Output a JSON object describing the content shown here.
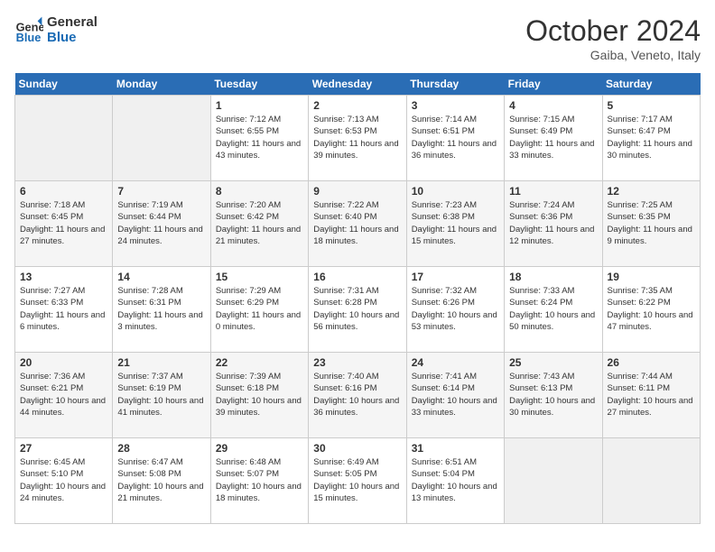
{
  "header": {
    "logo_line1": "General",
    "logo_line2": "Blue",
    "month": "October 2024",
    "location": "Gaiba, Veneto, Italy"
  },
  "days_of_week": [
    "Sunday",
    "Monday",
    "Tuesday",
    "Wednesday",
    "Thursday",
    "Friday",
    "Saturday"
  ],
  "weeks": [
    [
      {
        "day": "",
        "info": ""
      },
      {
        "day": "",
        "info": ""
      },
      {
        "day": "1",
        "info": "Sunrise: 7:12 AM\nSunset: 6:55 PM\nDaylight: 11 hours and 43 minutes."
      },
      {
        "day": "2",
        "info": "Sunrise: 7:13 AM\nSunset: 6:53 PM\nDaylight: 11 hours and 39 minutes."
      },
      {
        "day": "3",
        "info": "Sunrise: 7:14 AM\nSunset: 6:51 PM\nDaylight: 11 hours and 36 minutes."
      },
      {
        "day": "4",
        "info": "Sunrise: 7:15 AM\nSunset: 6:49 PM\nDaylight: 11 hours and 33 minutes."
      },
      {
        "day": "5",
        "info": "Sunrise: 7:17 AM\nSunset: 6:47 PM\nDaylight: 11 hours and 30 minutes."
      }
    ],
    [
      {
        "day": "6",
        "info": "Sunrise: 7:18 AM\nSunset: 6:45 PM\nDaylight: 11 hours and 27 minutes."
      },
      {
        "day": "7",
        "info": "Sunrise: 7:19 AM\nSunset: 6:44 PM\nDaylight: 11 hours and 24 minutes."
      },
      {
        "day": "8",
        "info": "Sunrise: 7:20 AM\nSunset: 6:42 PM\nDaylight: 11 hours and 21 minutes."
      },
      {
        "day": "9",
        "info": "Sunrise: 7:22 AM\nSunset: 6:40 PM\nDaylight: 11 hours and 18 minutes."
      },
      {
        "day": "10",
        "info": "Sunrise: 7:23 AM\nSunset: 6:38 PM\nDaylight: 11 hours and 15 minutes."
      },
      {
        "day": "11",
        "info": "Sunrise: 7:24 AM\nSunset: 6:36 PM\nDaylight: 11 hours and 12 minutes."
      },
      {
        "day": "12",
        "info": "Sunrise: 7:25 AM\nSunset: 6:35 PM\nDaylight: 11 hours and 9 minutes."
      }
    ],
    [
      {
        "day": "13",
        "info": "Sunrise: 7:27 AM\nSunset: 6:33 PM\nDaylight: 11 hours and 6 minutes."
      },
      {
        "day": "14",
        "info": "Sunrise: 7:28 AM\nSunset: 6:31 PM\nDaylight: 11 hours and 3 minutes."
      },
      {
        "day": "15",
        "info": "Sunrise: 7:29 AM\nSunset: 6:29 PM\nDaylight: 11 hours and 0 minutes."
      },
      {
        "day": "16",
        "info": "Sunrise: 7:31 AM\nSunset: 6:28 PM\nDaylight: 10 hours and 56 minutes."
      },
      {
        "day": "17",
        "info": "Sunrise: 7:32 AM\nSunset: 6:26 PM\nDaylight: 10 hours and 53 minutes."
      },
      {
        "day": "18",
        "info": "Sunrise: 7:33 AM\nSunset: 6:24 PM\nDaylight: 10 hours and 50 minutes."
      },
      {
        "day": "19",
        "info": "Sunrise: 7:35 AM\nSunset: 6:22 PM\nDaylight: 10 hours and 47 minutes."
      }
    ],
    [
      {
        "day": "20",
        "info": "Sunrise: 7:36 AM\nSunset: 6:21 PM\nDaylight: 10 hours and 44 minutes."
      },
      {
        "day": "21",
        "info": "Sunrise: 7:37 AM\nSunset: 6:19 PM\nDaylight: 10 hours and 41 minutes."
      },
      {
        "day": "22",
        "info": "Sunrise: 7:39 AM\nSunset: 6:18 PM\nDaylight: 10 hours and 39 minutes."
      },
      {
        "day": "23",
        "info": "Sunrise: 7:40 AM\nSunset: 6:16 PM\nDaylight: 10 hours and 36 minutes."
      },
      {
        "day": "24",
        "info": "Sunrise: 7:41 AM\nSunset: 6:14 PM\nDaylight: 10 hours and 33 minutes."
      },
      {
        "day": "25",
        "info": "Sunrise: 7:43 AM\nSunset: 6:13 PM\nDaylight: 10 hours and 30 minutes."
      },
      {
        "day": "26",
        "info": "Sunrise: 7:44 AM\nSunset: 6:11 PM\nDaylight: 10 hours and 27 minutes."
      }
    ],
    [
      {
        "day": "27",
        "info": "Sunrise: 6:45 AM\nSunset: 5:10 PM\nDaylight: 10 hours and 24 minutes."
      },
      {
        "day": "28",
        "info": "Sunrise: 6:47 AM\nSunset: 5:08 PM\nDaylight: 10 hours and 21 minutes."
      },
      {
        "day": "29",
        "info": "Sunrise: 6:48 AM\nSunset: 5:07 PM\nDaylight: 10 hours and 18 minutes."
      },
      {
        "day": "30",
        "info": "Sunrise: 6:49 AM\nSunset: 5:05 PM\nDaylight: 10 hours and 15 minutes."
      },
      {
        "day": "31",
        "info": "Sunrise: 6:51 AM\nSunset: 5:04 PM\nDaylight: 10 hours and 13 minutes."
      },
      {
        "day": "",
        "info": ""
      },
      {
        "day": "",
        "info": ""
      }
    ]
  ]
}
